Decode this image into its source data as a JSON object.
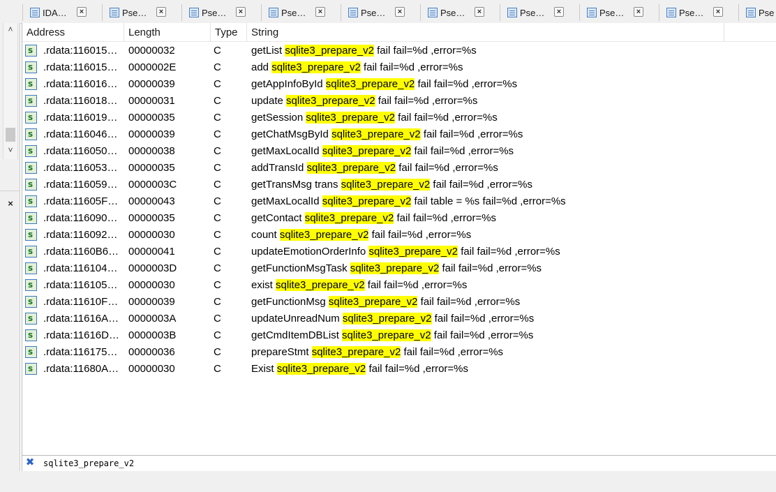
{
  "tabs": [
    {
      "label": "IDA…"
    },
    {
      "label": "Pse…"
    },
    {
      "label": "Pse…"
    },
    {
      "label": "Pse…"
    },
    {
      "label": "Pse…"
    },
    {
      "label": "Pse…"
    },
    {
      "label": "Pse…"
    },
    {
      "label": "Pse…"
    },
    {
      "label": "Pse…"
    },
    {
      "label": "Pse"
    }
  ],
  "tab_close_glyph": "×",
  "left_panel": {
    "close_glyph": "×",
    "up_glyph": "˄",
    "down_glyph": "˅"
  },
  "columns": {
    "address": "Address",
    "length": "Length",
    "type": "Type",
    "string": "String"
  },
  "icon_letter": "s",
  "rows": [
    {
      "address": ".rdata:116015…",
      "length": "00000032",
      "type": "C",
      "pre": "getList ",
      "match": "sqlite3_prepare_v2",
      "post": " fail fail=%d ,error=%s"
    },
    {
      "address": ".rdata:116015…",
      "length": "0000002E",
      "type": "C",
      "pre": "add ",
      "match": "sqlite3_prepare_v2",
      "post": " fail fail=%d ,error=%s"
    },
    {
      "address": ".rdata:116016…",
      "length": "00000039",
      "type": "C",
      "pre": "getAppInfoById ",
      "match": "sqlite3_prepare_v2",
      "post": " fail fail=%d ,error=%s"
    },
    {
      "address": ".rdata:116018…",
      "length": "00000031",
      "type": "C",
      "pre": "update ",
      "match": "sqlite3_prepare_v2",
      "post": " fail fail=%d ,error=%s"
    },
    {
      "address": ".rdata:116019…",
      "length": "00000035",
      "type": "C",
      "pre": "getSession ",
      "match": "sqlite3_prepare_v2",
      "post": " fail fail=%d ,error=%s"
    },
    {
      "address": ".rdata:116046…",
      "length": "00000039",
      "type": "C",
      "pre": "getChatMsgById ",
      "match": "sqlite3_prepare_v2",
      "post": " fail fail=%d ,error=%s"
    },
    {
      "address": ".rdata:116050…",
      "length": "00000038",
      "type": "C",
      "pre": "getMaxLocalId ",
      "match": "sqlite3_prepare_v2",
      "post": " fail fail=%d ,error=%s"
    },
    {
      "address": ".rdata:116053…",
      "length": "00000035",
      "type": "C",
      "pre": "addTransId ",
      "match": "sqlite3_prepare_v2",
      "post": " fail fail=%d ,error=%s"
    },
    {
      "address": ".rdata:116059…",
      "length": "0000003C",
      "type": "C",
      "pre": "getTransMsg trans ",
      "match": "sqlite3_prepare_v2",
      "post": " fail fail=%d ,error=%s"
    },
    {
      "address": ".rdata:11605F…",
      "length": "00000043",
      "type": "C",
      "pre": "getMaxLocalId ",
      "match": "sqlite3_prepare_v2",
      "post": " fail table = %s fail=%d ,error=%s"
    },
    {
      "address": ".rdata:116090…",
      "length": "00000035",
      "type": "C",
      "pre": "getContact ",
      "match": "sqlite3_prepare_v2",
      "post": " fail fail=%d ,error=%s"
    },
    {
      "address": ".rdata:116092…",
      "length": "00000030",
      "type": "C",
      "pre": "count ",
      "match": "sqlite3_prepare_v2",
      "post": " fail fail=%d ,error=%s"
    },
    {
      "address": ".rdata:1160B6…",
      "length": "00000041",
      "type": "C",
      "pre": "updateEmotionOrderInfo ",
      "match": "sqlite3_prepare_v2",
      "post": " fail fail=%d ,error=%s"
    },
    {
      "address": ".rdata:116104…",
      "length": "0000003D",
      "type": "C",
      "pre": "getFunctionMsgTask ",
      "match": "sqlite3_prepare_v2",
      "post": " fail fail=%d ,error=%s"
    },
    {
      "address": ".rdata:116105…",
      "length": "00000030",
      "type": "C",
      "pre": "exist ",
      "match": "sqlite3_prepare_v2",
      "post": " fail fail=%d ,error=%s"
    },
    {
      "address": ".rdata:11610F…",
      "length": "00000039",
      "type": "C",
      "pre": "getFunctionMsg ",
      "match": "sqlite3_prepare_v2",
      "post": " fail fail=%d ,error=%s"
    },
    {
      "address": ".rdata:11616A…",
      "length": "0000003A",
      "type": "C",
      "pre": "updateUnreadNum ",
      "match": "sqlite3_prepare_v2",
      "post": " fail fail=%d ,error=%s"
    },
    {
      "address": ".rdata:11616D…",
      "length": "0000003B",
      "type": "C",
      "pre": "getCmdItemDBList ",
      "match": "sqlite3_prepare_v2",
      "post": " fail fail=%d ,error=%s"
    },
    {
      "address": ".rdata:116175…",
      "length": "00000036",
      "type": "C",
      "pre": "prepareStmt ",
      "match": "sqlite3_prepare_v2",
      "post": " fail fail=%d ,error=%s"
    },
    {
      "address": ".rdata:11680A…",
      "length": "00000030",
      "type": "C",
      "pre": "Exist ",
      "match": "sqlite3_prepare_v2",
      "post": " fail fail=%d ,error=%s"
    }
  ],
  "filter": {
    "clear_glyph": "✖",
    "value": "sqlite3_prepare_v2"
  },
  "colors": {
    "highlight": "#ffff00",
    "icon_green": "#1e7a2a",
    "icon_border": "#3c79bf",
    "filter_clear": "#2a63c6"
  }
}
